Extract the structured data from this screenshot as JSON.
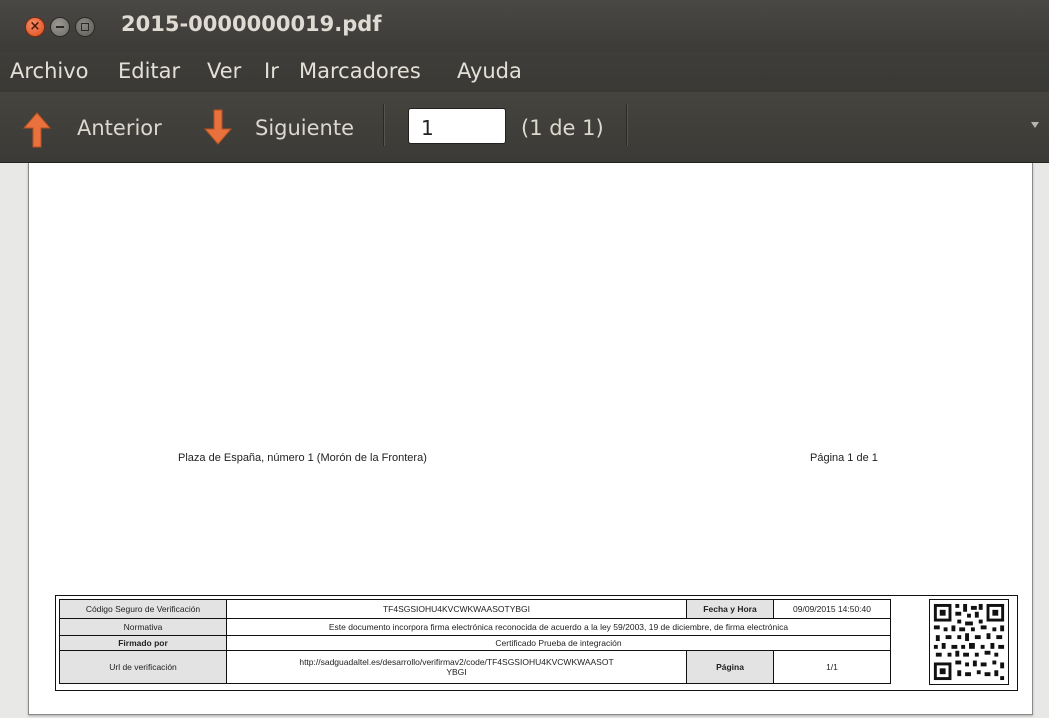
{
  "window": {
    "title": "2015-0000000019.pdf"
  },
  "menu": [
    "Archivo",
    "Editar",
    "Ver",
    "Ir",
    "Marcadores",
    "Ayuda"
  ],
  "toolbar": {
    "prev_label": "Anterior",
    "next_label": "Siguiente",
    "page_value": "1",
    "page_count": "(1 de 1)"
  },
  "document": {
    "footer_address": "Plaza de España, número 1 (Morón de la Frontera)",
    "footer_page": "Página 1 de 1",
    "signature": {
      "csv_label": "Código Seguro de Verificación",
      "csv_value": "TF4SGSIOHU4KVCWKWAASOTYBGI",
      "date_label": "Fecha y Hora",
      "date_value": "09/09/2015 14:50:40",
      "norm_label": "Normativa",
      "norm_value": "Este documento incorpora firma electrónica reconocida de acuerdo a la ley 59/2003, 19 de diciembre, de firma electrónica",
      "signed_label": "Firmado por",
      "signed_value": "Certificado Prueba de integración",
      "url_label": "Url de verificación",
      "url_value_1": "http://sadguadaltel.es/desarrollo/verifirmav2/code/TF4SGSIOHU4KVCWKWAASOT",
      "url_value_2": "YBGI",
      "page_label": "Página",
      "page_value": "1/1"
    }
  },
  "colors": {
    "accent_arrow": "#e9713e",
    "titlebar": "#3c3b37"
  }
}
